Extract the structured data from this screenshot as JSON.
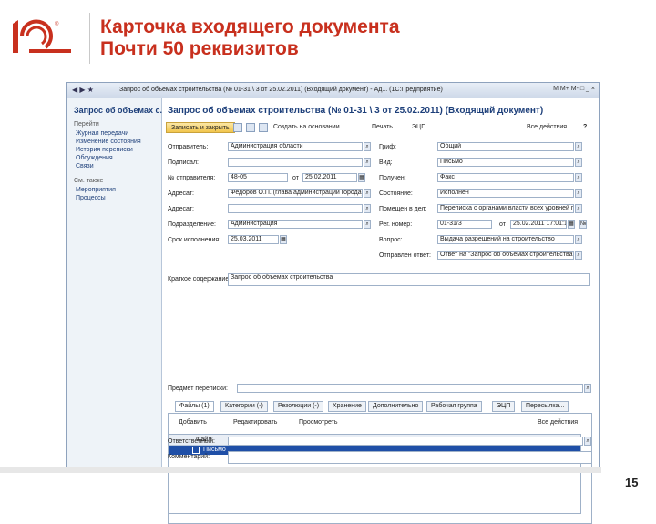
{
  "slide": {
    "title_line1": "Карточка входящего документа",
    "title_line2": "Почти 50 реквизитов",
    "page_number": "15",
    "logo_text": "1С"
  },
  "window": {
    "title": "Запрос об объемах строительства (№ 01-31 \\ 3 от 25.02.2011) (Входящий документ) - Ад... (1С:Предприятие)",
    "title_buttons": "M  M+  M-  □  _  ×"
  },
  "sidebar": {
    "title": "Запрос об объемах с...",
    "sections": [
      {
        "label": "Перейти",
        "items": [
          "Журнал передачи",
          "Изменение состояния",
          "История переписки",
          "Обсуждения",
          "Связи"
        ]
      },
      {
        "label": "См. также",
        "items": [
          "Мероприятия",
          "Процессы"
        ]
      }
    ]
  },
  "form": {
    "title": "Запрос об объемах строительства (№ 01-31 \\ 3 от 25.02.2011) (Входящий документ)",
    "toolbar": {
      "primary": "Записать и закрыть",
      "create_based": "Создать на основании",
      "print": "Печать",
      "esp": "ЭЦП",
      "all_actions": "Все действия"
    },
    "left_fields": [
      {
        "label": "Отправитель:",
        "value": "Администрация области"
      },
      {
        "label": "Подписал:",
        "value": ""
      },
      {
        "label": "№ отправителя:",
        "value": "48-05",
        "date_label": "от",
        "date_value": "25.02.2011"
      },
      {
        "label": "Адресат:",
        "value": "Федоров О.П. (глава администрации города)"
      },
      {
        "label": "Адресат:",
        "value": ""
      },
      {
        "label": "Подразделение:",
        "value": "Администрация"
      },
      {
        "label": "Срок исполнения:",
        "value": "25.03.2011"
      }
    ],
    "right_fields": [
      {
        "label": "Гриф:",
        "value": "Общий"
      },
      {
        "label": "Вид:",
        "value": "Письмо"
      },
      {
        "label": "Получен:",
        "value": "Факс"
      },
      {
        "label": "Состояние:",
        "value": "Исполнен"
      },
      {
        "label": "Помещен в дел:",
        "value": "Переписка с органами власти всех уровней по"
      },
      {
        "label": "Рег. номер:",
        "value": "01-31/3",
        "date_label": "от",
        "date_value": "25.02.2011 17:01:16"
      },
      {
        "label": "Вопрос:",
        "value": "Выдача разрешений на строительство"
      },
      {
        "label": "Отправлен ответ:",
        "value": "Ответ на \"Запрос об объемах строительства\""
      }
    ],
    "summary_label": "Краткое содержание:",
    "summary_value": "Запрос об объемах строительства",
    "subject_label": "Предмет переписки:",
    "subject_value": "",
    "tabs": [
      "Файлы (1)",
      "Категории (-)",
      "Резолюции (-)",
      "Хранение",
      "Дополнительно",
      "Рабочая группа",
      "ЭЦП",
      "Пересылка..."
    ],
    "files_toolbar": {
      "add": "Добавить",
      "edit": "Редактировать",
      "open": "Просмотреть",
      "more": "Все действия"
    },
    "grid_header": "Файл",
    "grid_rows": [
      "Письмо"
    ],
    "responsible_label": "Ответственный:",
    "responsible_value": "",
    "comment_label": "Комментарий:",
    "comment_value": ""
  }
}
